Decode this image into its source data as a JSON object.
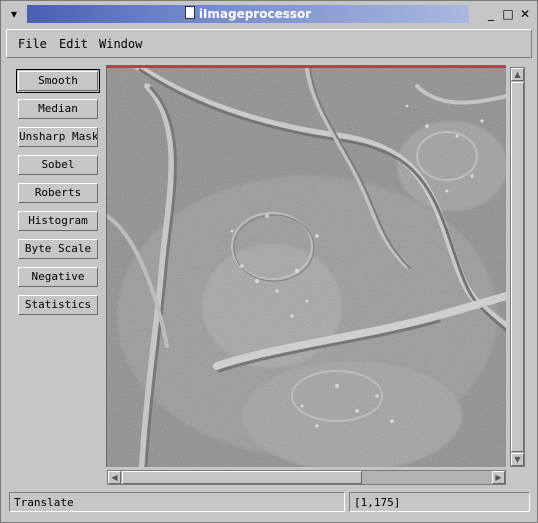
{
  "window": {
    "title": "iImageprocessor",
    "menu_glyph": "▾",
    "minimize_glyph": "_",
    "maximize_glyph": "□",
    "close_glyph": "✕"
  },
  "menubar": {
    "items": [
      "File",
      "Edit",
      "Window"
    ]
  },
  "tools": {
    "buttons": [
      "Smooth",
      "Median",
      "Unsharp Mask",
      "Sobel",
      "Roberts",
      "Histogram",
      "Byte Scale",
      "Negative",
      "Statistics"
    ],
    "active": "Smooth"
  },
  "scroll": {
    "up": "▲",
    "down": "▼",
    "left": "◀",
    "right": "▶"
  },
  "status": {
    "mode": "Translate",
    "coords": "[1,175]"
  },
  "colors": {
    "chrome": "#c6c6c6",
    "title_gradient_start": "#4a5fb0",
    "title_gradient_end": "#aab8e0",
    "canvas_top_line": "#c43a3a"
  }
}
